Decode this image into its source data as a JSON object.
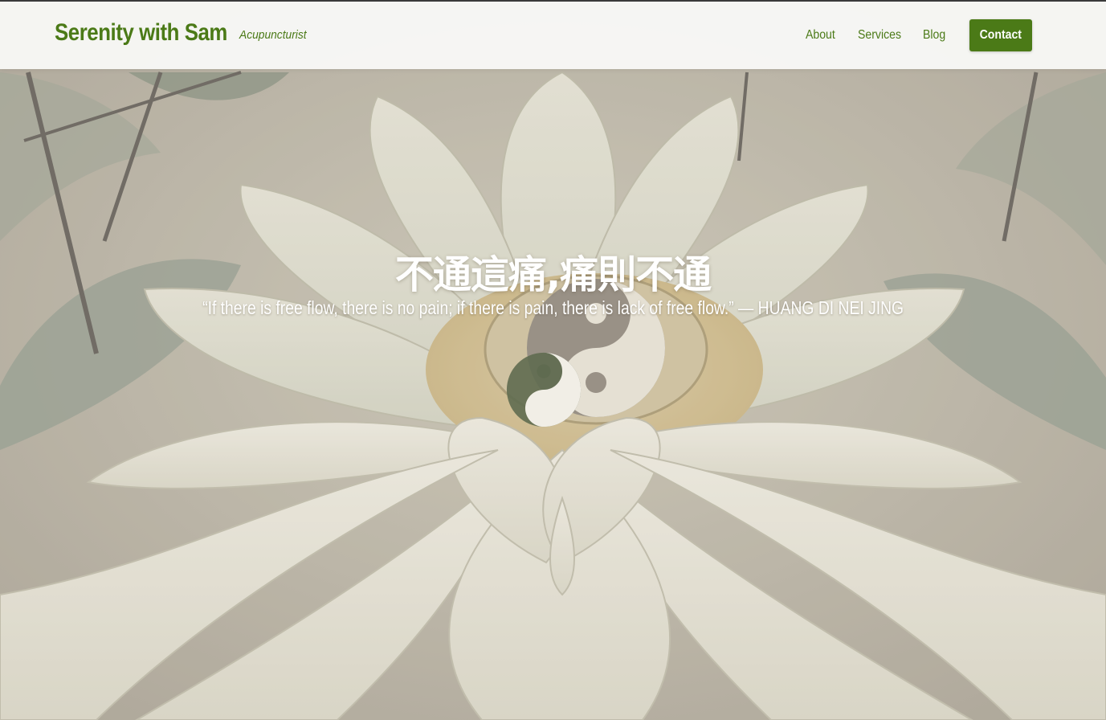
{
  "header": {
    "brand": "Serenity with Sam",
    "tagline": "Acupuncturist",
    "nav": [
      "About",
      "Services",
      "Blog"
    ],
    "contact_label": "Contact"
  },
  "hero": {
    "title": "不通這痛,痛則不通",
    "quote": "“If there is free flow, there is no pain; if there is pain, there is lack of free flow.” — HUANG DI NEI JING",
    "background": "lotus-flower-illustration",
    "icon": "yin-yang-icon"
  },
  "colors": {
    "brand_green": "#4b7a17",
    "header_bg": "#f8f8f6",
    "petal": "#e6e3d6",
    "leaf": "#8e9a82"
  }
}
